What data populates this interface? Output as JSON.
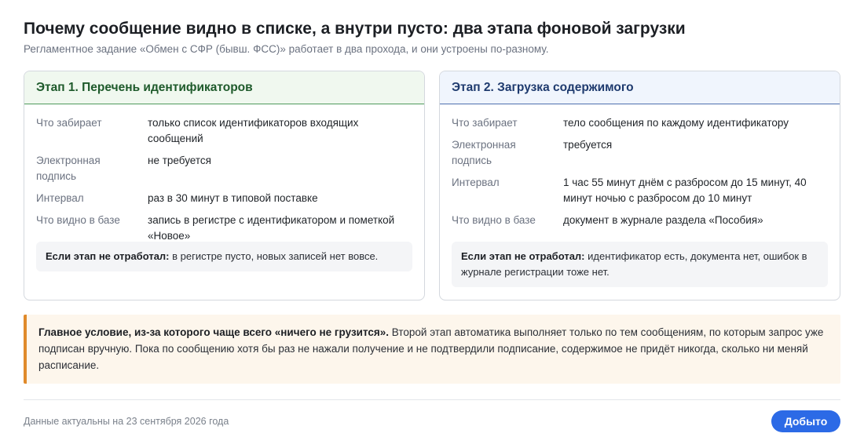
{
  "title": "Почему сообщение видно в списке, а внутри пусто: два этапа фоновой загрузки",
  "subtitle": "Регламентное задание «Обмен с СФР (бывш. ФСС)» работает в два прохода, и они устроены по-разному.",
  "stage1": {
    "header": "Этап 1. Перечень идентификаторов",
    "rows": [
      {
        "label": "Что забирает",
        "value": "только список идентификаторов входящих сообщений"
      },
      {
        "label": "Электронная подпись",
        "value": "не требуется"
      },
      {
        "label": "Интервал",
        "value": "раз в 30 минут в типовой поставке"
      },
      {
        "label": "Что видно в базе",
        "value": "запись в регистре с идентификатором и пометкой «Новое»"
      }
    ],
    "note_bold": "Если этап не отработал:",
    "note_text": " в регистре пусто, новых записей нет вовсе."
  },
  "stage2": {
    "header": "Этап 2. Загрузка содержимого",
    "rows": [
      {
        "label": "Что забирает",
        "value": "тело сообщения по каждому идентификатору"
      },
      {
        "label": "Электронная подпись",
        "value": "требуется"
      },
      {
        "label": "Интервал",
        "value": "1 час 55 минут днём с разбросом до 15 минут, 40 минут ночью с разбросом до 10 минут"
      },
      {
        "label": "Что видно в базе",
        "value": "документ в журнале раздела «Пособия»"
      }
    ],
    "note_bold": "Если этап не отработал:",
    "note_text": " идентификатор есть, документа нет, ошибок в журнале регистрации тоже нет."
  },
  "callout": {
    "bold": "Главное условие, из-за которого чаще всего «ничего не грузится».",
    "text": " Второй этап автоматика выполняет только по тем сообщениям, по которым запрос уже подписан вручную. Пока по сообщению хотя бы раз не нажали получение и не подтвердили подписание, содержимое не придёт никогда, сколько ни меняй расписание."
  },
  "footer": {
    "date_text": "Данные актуальны на 23 сентября 2026 года",
    "ok_label": "Добыто"
  },
  "colors": {
    "stage1_accent": "#4f9a5c",
    "stage2_accent": "#4d6fae",
    "callout_accent": "#e08a2a",
    "button": "#2c6ae6"
  }
}
